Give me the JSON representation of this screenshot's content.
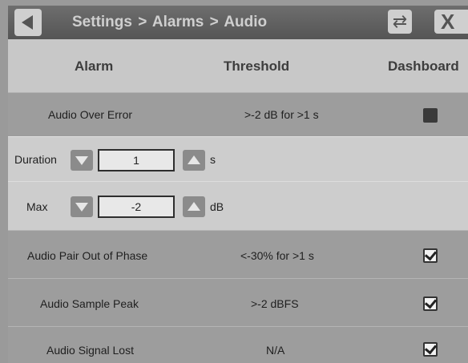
{
  "header": {
    "breadcrumb": [
      "Settings",
      "Alarms",
      "Audio"
    ],
    "separator": ">"
  },
  "columns": {
    "alarm": "Alarm",
    "threshold": "Threshold",
    "dashboard": "Dashboard"
  },
  "rows": [
    {
      "alarm": "Audio Over Error",
      "threshold": ">-2 dB for >1 s",
      "dashboard": false
    },
    {
      "alarm": "Audio Pair Out of Phase",
      "threshold": "<-30% for >1 s",
      "dashboard": true
    },
    {
      "alarm": "Audio Sample Peak",
      "threshold": ">-2 dBFS",
      "dashboard": true
    },
    {
      "alarm": "Audio Signal Lost",
      "threshold": "N/A",
      "dashboard": true
    }
  ],
  "settings": {
    "duration": {
      "label": "Duration",
      "value": "1",
      "unit": "s"
    },
    "max": {
      "label": "Max",
      "value": "-2",
      "unit": "dB"
    }
  },
  "icons": {
    "back": "back-arrow-icon",
    "swap": "swap-icon",
    "close": "close-icon",
    "down": "triangle-down-icon",
    "up": "triangle-up-icon"
  }
}
